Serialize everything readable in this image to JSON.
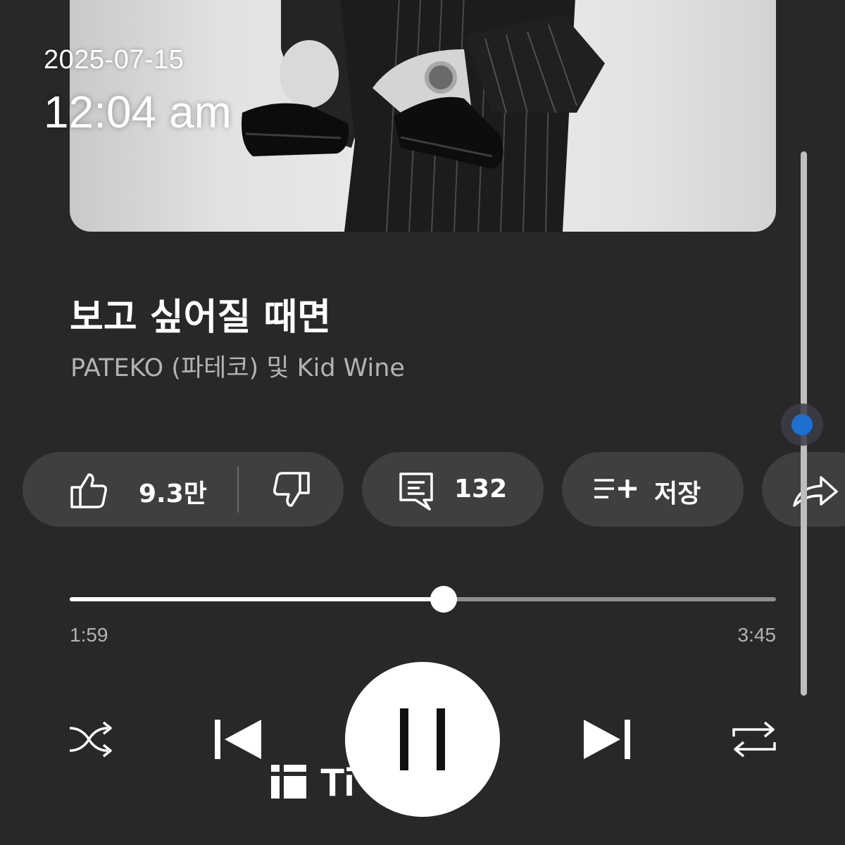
{
  "status_overlay": {
    "date": "2025-07-15",
    "time": "12:04 am"
  },
  "track": {
    "title": "보고 싶어질 때면",
    "artist": "PATEKO (파테코) 및 Kid Wine"
  },
  "actions": {
    "like_count": "9.3만",
    "comment_count": "132",
    "save_label": "저장"
  },
  "playback": {
    "current_time": "1:59",
    "total_time": "3:45",
    "progress_fraction": 0.529
  },
  "watermark": {
    "text": "Threads",
    "visible_text": "Ti ead"
  },
  "colors": {
    "background": "#282828",
    "pill": "#3f3f3f",
    "scroll_accent": "#1e6fd0"
  },
  "icons": {
    "like": "thumbs-up-icon",
    "dislike": "thumbs-down-icon",
    "comment": "comment-icon",
    "save": "playlist-add-icon",
    "share": "share-icon",
    "shuffle": "shuffle-icon",
    "previous": "skip-previous-icon",
    "pause": "pause-icon",
    "next": "skip-next-icon",
    "repeat": "repeat-icon",
    "watermark": "threads-logo-icon"
  }
}
